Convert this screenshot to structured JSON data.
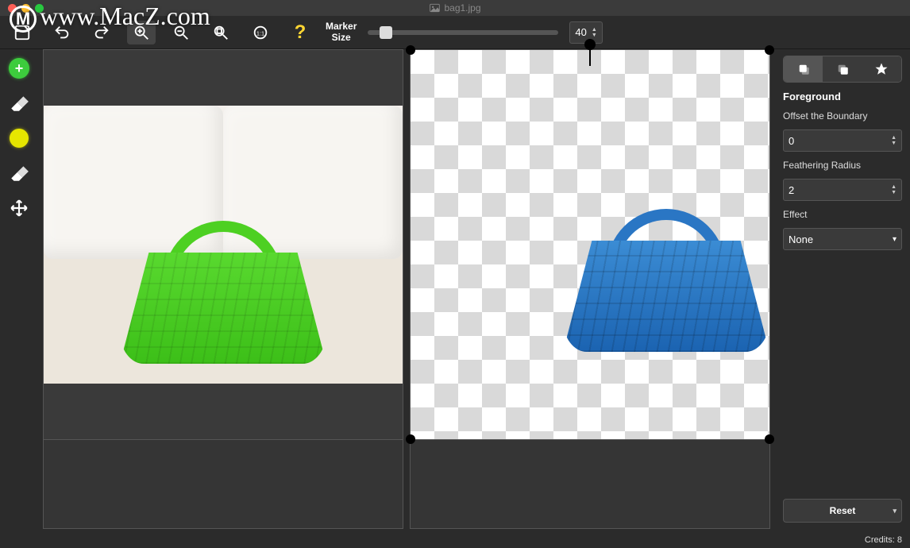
{
  "window": {
    "filename": "bag1.jpg"
  },
  "watermark": {
    "text": "www.MacZ.com"
  },
  "toolbar": {
    "marker_size_label": "Marker\nSize",
    "marker_size_value": "40"
  },
  "right_panel": {
    "section_title": "Foreground",
    "offset_label": "Offset the Boundary",
    "offset_value": "0",
    "feather_label": "Feathering Radius",
    "feather_value": "2",
    "effect_label": "Effect",
    "effect_value": "None",
    "reset_label": "Reset"
  },
  "statusbar": {
    "credits": "Credits: 8"
  },
  "icons": {
    "add": "+",
    "help": "?",
    "dropdown": "▾"
  }
}
